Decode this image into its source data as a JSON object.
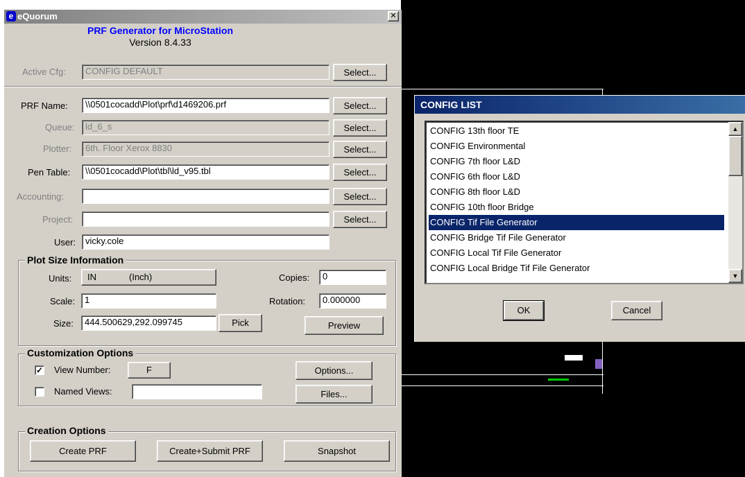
{
  "window": {
    "title": "eQuorum",
    "close_glyph": "✕",
    "header_title": "PRF Generator for MicroStation",
    "version": "Version  8.4.33",
    "accent_title_color": "#0000ff"
  },
  "active_cfg": {
    "label": "Active Cfg:",
    "value": "CONFIG DEFAULT",
    "button": "Select..."
  },
  "rows": [
    {
      "label": "PRF Name:",
      "value": "\\\\0501cocadd\\Plot\\prf\\d1469206.prf",
      "button": "Select..."
    },
    {
      "label": "Queue:",
      "value": "ld_6_s",
      "button": "Select..."
    },
    {
      "label": "Plotter:",
      "value": "6th. Floor Xerox 8830",
      "button": "Select..."
    },
    {
      "label": "Pen Table:",
      "value": "\\\\0501cocadd\\Plot\\tbl\\ld_v95.tbl",
      "button": "Select..."
    },
    {
      "label": "Accounting:",
      "value": "",
      "button": "Select..."
    },
    {
      "label": "Project:",
      "value": "",
      "button": "Select..."
    },
    {
      "label": "User:",
      "value": "vicky.cole"
    }
  ],
  "plot_size": {
    "title": "Plot Size Information",
    "units_label": "Units:",
    "units_value": "IN",
    "units_desc": "(Inch)",
    "copies_label": "Copies:",
    "copies_value": "0",
    "scale_label": "Scale:",
    "scale_value": "1",
    "rotation_label": "Rotation:",
    "rotation_value": "0.000000",
    "size_label": "Size:",
    "size_value": "444.500629,292.099745",
    "pick_button": "Pick",
    "preview_button": "Preview"
  },
  "customization": {
    "title": "Customization Options",
    "view_number_checked": true,
    "view_number_label": "View Number:",
    "view_number_value": "F",
    "named_views_checked": false,
    "named_views_label": "Named Views:",
    "named_views_value": "",
    "options_button": "Options...",
    "files_button": "Files..."
  },
  "creation": {
    "title": "Creation Options",
    "create_button": "Create PRF",
    "create_submit_button": "Create+Submit PRF",
    "snapshot_button": "Snapshot"
  },
  "config_list": {
    "title": "CONFIG LIST",
    "items": [
      "CONFIG 13th floor TE",
      "CONFIG Environmental",
      "CONFIG 7th floor L&D",
      "CONFIG 6th floor L&D",
      "CONFIG 8th floor L&D",
      "CONFIG 10th floor Bridge",
      "CONFIG Tif File Generator",
      "CONFIG Bridge Tif File Generator",
      "CONFIG Local Tif File Generator",
      "CONFIG Local Bridge Tif File Generator"
    ],
    "selected_index": 6,
    "ok_button": "OK",
    "cancel_button": "Cancel",
    "selection_color": "#0a246a"
  }
}
